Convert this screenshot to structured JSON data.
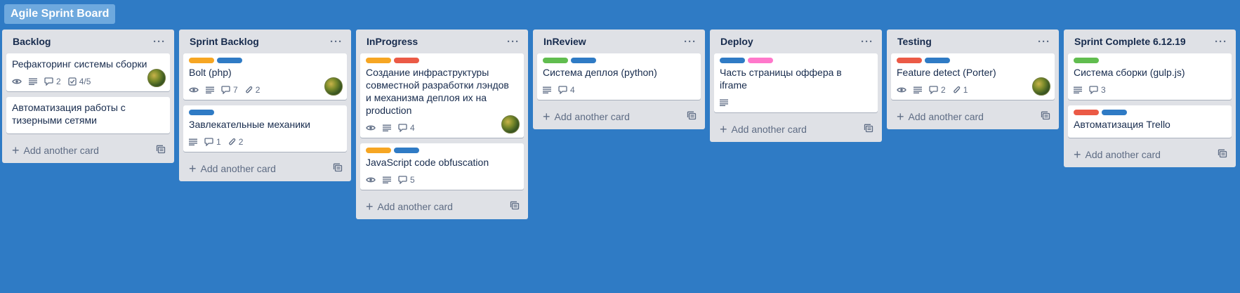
{
  "board": {
    "title": "Agile Sprint Board",
    "background": "#2f7bc5"
  },
  "label_colors": {
    "orange": "#f6a623",
    "blue": "#2f7bc5",
    "red": "#eb5a46",
    "green": "#61bd4f",
    "pink": "#ff78cb"
  },
  "add_card_label": "Add another card",
  "list_menu_label": "···",
  "lists": [
    {
      "title": "Backlog",
      "cards": [
        {
          "labels": [],
          "title": "Рефакторинг системы сборки",
          "watch": true,
          "description": true,
          "comments": "2",
          "checklist": "4/5",
          "attachments": null,
          "avatar": true
        },
        {
          "labels": [],
          "title": "Автоматизация работы с тизерными сетями",
          "watch": false,
          "description": false,
          "comments": null,
          "checklist": null,
          "attachments": null,
          "avatar": false
        }
      ]
    },
    {
      "title": "Sprint Backlog",
      "cards": [
        {
          "labels": [
            "orange",
            "blue"
          ],
          "title": "Bolt (php)",
          "watch": true,
          "description": true,
          "comments": "7",
          "checklist": null,
          "attachments": "2",
          "avatar": true
        },
        {
          "labels": [
            "blue"
          ],
          "title": "Завлекательные механики",
          "watch": false,
          "description": true,
          "comments": "1",
          "checklist": null,
          "attachments": "2",
          "avatar": false
        }
      ]
    },
    {
      "title": "InProgress",
      "cards": [
        {
          "labels": [
            "orange",
            "red"
          ],
          "title": "Создание инфраструктуры совместной разработки лэндов и механизма деплоя их на production",
          "watch": true,
          "description": true,
          "comments": "4",
          "checklist": null,
          "attachments": null,
          "avatar": true
        },
        {
          "labels": [
            "orange",
            "blue"
          ],
          "title": "JavaScript code obfuscation",
          "watch": true,
          "description": true,
          "comments": "5",
          "checklist": null,
          "attachments": null,
          "avatar": false
        }
      ]
    },
    {
      "title": "InReview",
      "cards": [
        {
          "labels": [
            "green",
            "blue"
          ],
          "title": "Система деплоя (python)",
          "watch": false,
          "description": true,
          "comments": "4",
          "checklist": null,
          "attachments": null,
          "avatar": false
        }
      ]
    },
    {
      "title": "Deploy",
      "cards": [
        {
          "labels": [
            "blue",
            "pink"
          ],
          "title": "Часть страницы оффера в iframe",
          "watch": false,
          "description": true,
          "comments": null,
          "checklist": null,
          "attachments": null,
          "avatar": false
        }
      ]
    },
    {
      "title": "Testing",
      "cards": [
        {
          "labels": [
            "red",
            "blue"
          ],
          "title": "Feature detect (Porter)",
          "watch": true,
          "description": true,
          "comments": "2",
          "checklist": null,
          "attachments": "1",
          "avatar": true
        }
      ]
    },
    {
      "title": "Sprint Complete 6.12.19",
      "cards": [
        {
          "labels": [
            "green"
          ],
          "title": "Система сборки (gulp.js)",
          "watch": false,
          "description": true,
          "comments": "3",
          "checklist": null,
          "attachments": null,
          "avatar": false
        },
        {
          "labels": [
            "red",
            "blue"
          ],
          "title": "Автоматизация Trello",
          "watch": false,
          "description": false,
          "comments": null,
          "checklist": null,
          "attachments": null,
          "avatar": false
        }
      ]
    }
  ]
}
